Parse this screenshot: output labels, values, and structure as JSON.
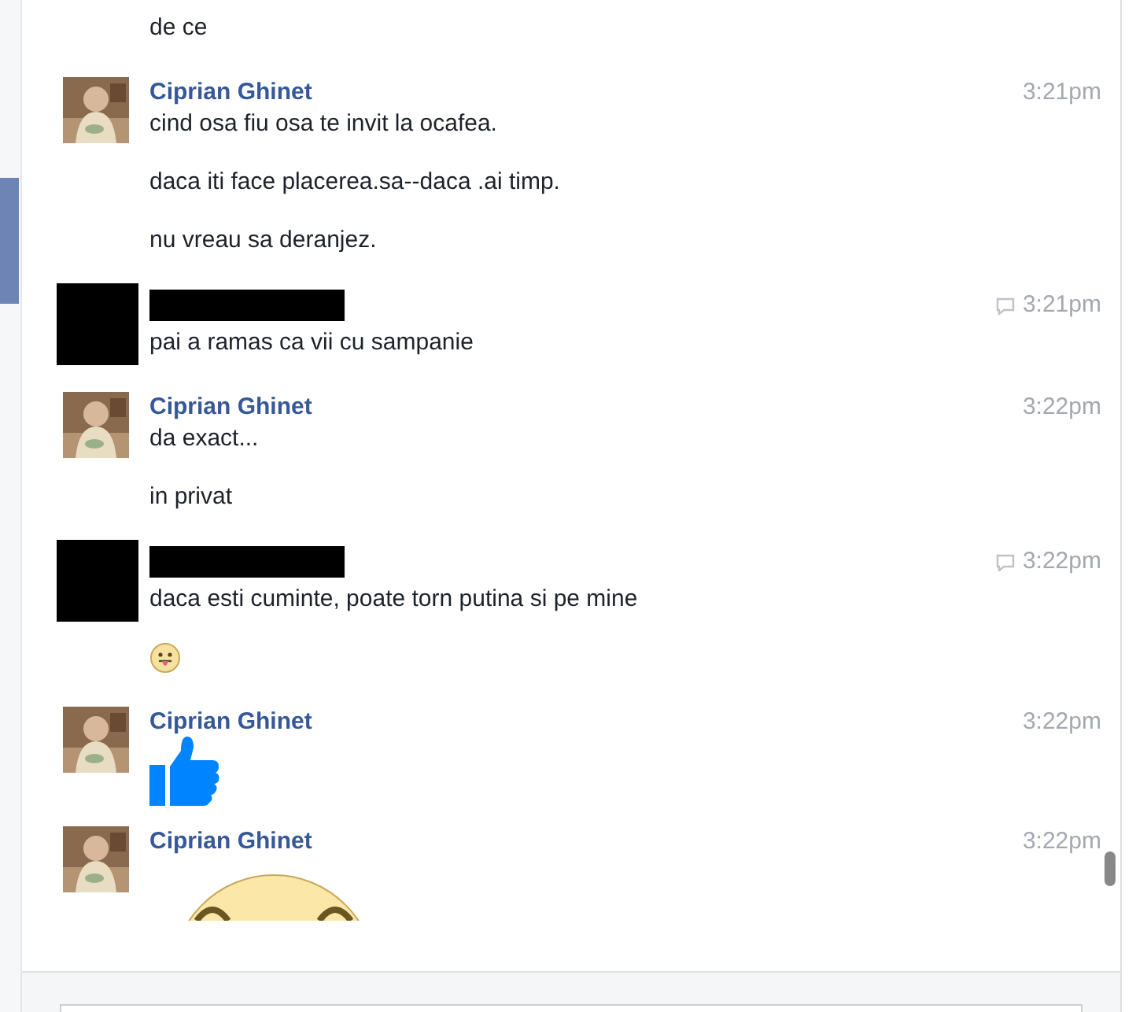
{
  "messages": [
    {
      "kind": "continuation",
      "lines": [
        {
          "kind": "text",
          "text": "de ce"
        }
      ]
    },
    {
      "kind": "named",
      "sender": "Ciprian Ghinet",
      "time": "3:21pm",
      "seen_icon": false,
      "lines": [
        {
          "kind": "text",
          "text": "cind osa fiu osa te invit la ocafea."
        },
        {
          "kind": "text",
          "text": "daca iti face placerea.sa--daca .ai timp."
        },
        {
          "kind": "text",
          "text": "nu vreau sa deranjez."
        }
      ]
    },
    {
      "kind": "redacted",
      "time": "3:21pm",
      "seen_icon": true,
      "lines": [
        {
          "kind": "text",
          "text": "pai a ramas ca vii cu sampanie"
        }
      ]
    },
    {
      "kind": "named",
      "sender": "Ciprian Ghinet",
      "time": "3:22pm",
      "seen_icon": false,
      "lines": [
        {
          "kind": "text",
          "text": "da exact..."
        },
        {
          "kind": "text",
          "text": "in privat"
        }
      ]
    },
    {
      "kind": "redacted",
      "time": "3:22pm",
      "seen_icon": true,
      "lines": [
        {
          "kind": "text",
          "text": "daca esti cuminte, poate torn putina si pe mine"
        },
        {
          "kind": "emoji"
        }
      ]
    },
    {
      "kind": "named",
      "sender": "Ciprian Ghinet",
      "time": "3:22pm",
      "seen_icon": false,
      "lines": [
        {
          "kind": "like"
        }
      ]
    },
    {
      "kind": "named",
      "sender": "Ciprian Ghinet",
      "time": "3:22pm",
      "seen_icon": false,
      "lines": [
        {
          "kind": "big-emoji"
        }
      ]
    }
  ]
}
